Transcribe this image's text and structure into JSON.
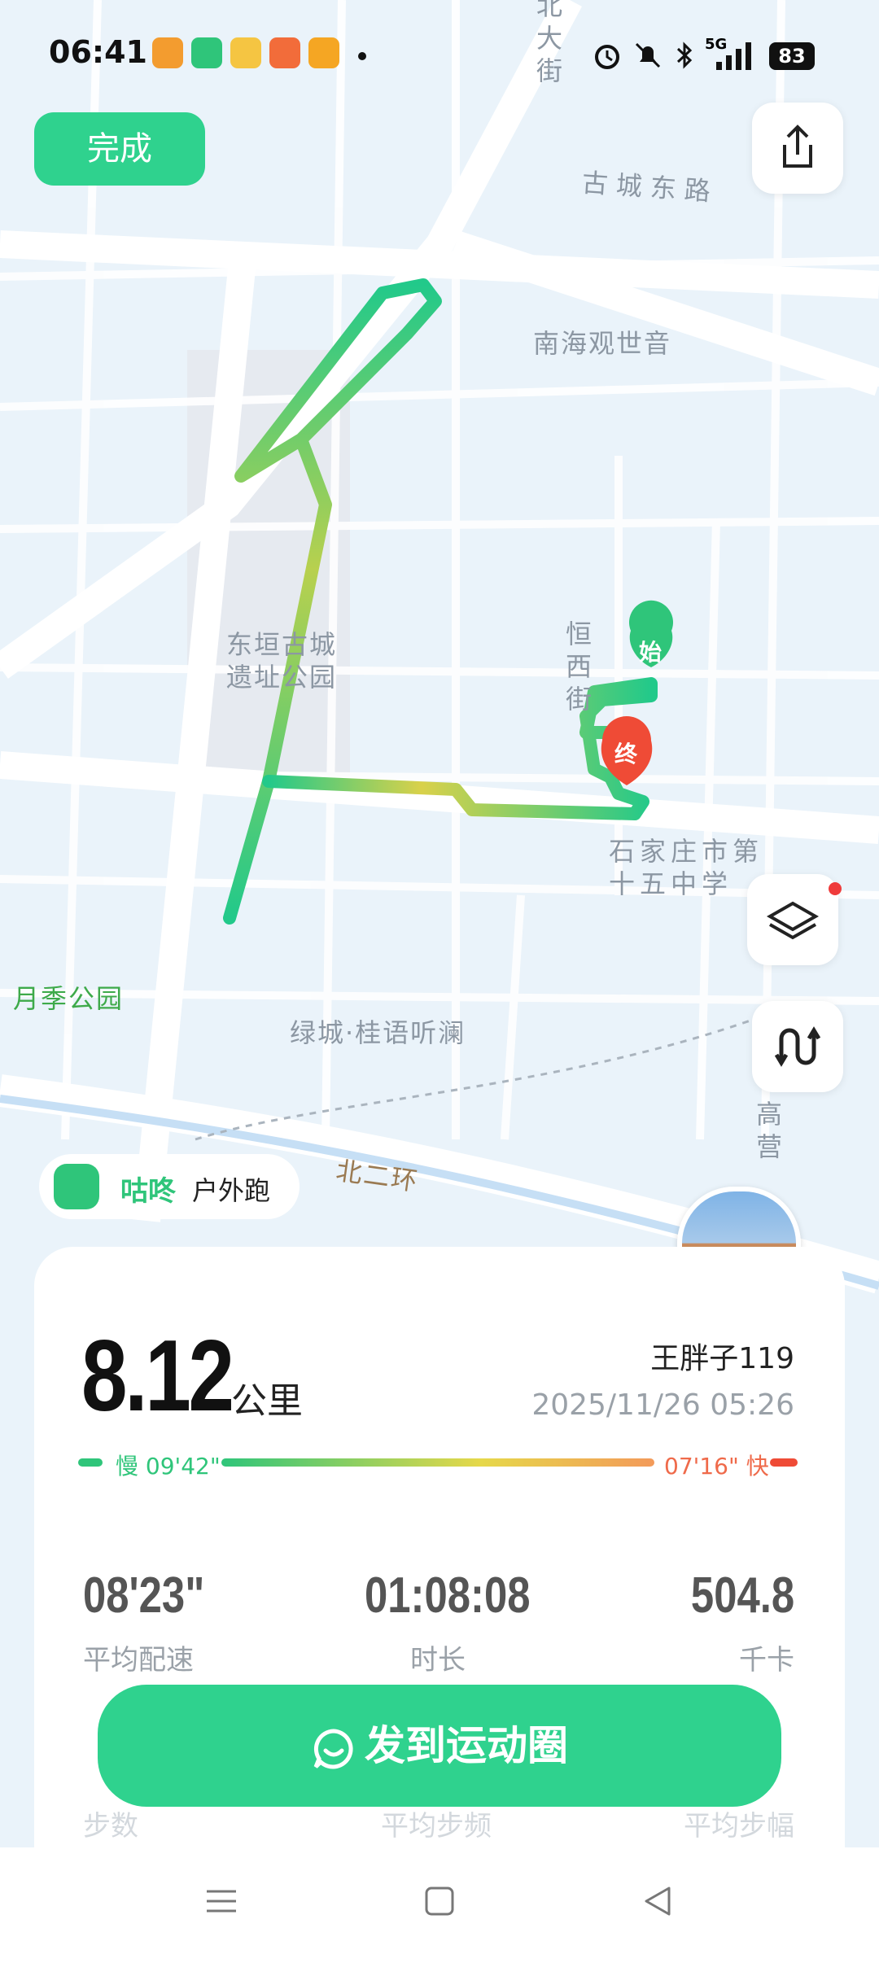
{
  "status_bar": {
    "time": "06:41",
    "network": "5G",
    "battery": "83",
    "icons": [
      "alarm-icon",
      "mute-bell-icon",
      "bluetooth-icon",
      "signal-icon"
    ]
  },
  "top_actions": {
    "done_label": "完成",
    "share_icon": "share-icon"
  },
  "map": {
    "labels": {
      "street_top": "北大街",
      "gucheng_east": "古城东路",
      "nanhai": "南海观世音",
      "park": "东垣古城\n遗址公园",
      "hengxi": "恒西街",
      "school": "石家庄市第\n十五中学",
      "yueji": "月季公园",
      "lvcheng": "绿城·桂语听澜",
      "beierhuan": "北二环",
      "gaoying": "高营"
    },
    "start_marker": "始",
    "end_marker": "终",
    "colors": {
      "route_green": "#22c98a",
      "route_yellow": "#d9d14a",
      "start": "#2fc57a",
      "end": "#ef4b36"
    }
  },
  "app_badge": {
    "brand": "咕咚",
    "activity": "户外跑"
  },
  "summary": {
    "distance": "8.12",
    "unit": "公里",
    "user": "王胖子119",
    "datetime": "2025/11/26 05:26",
    "pace_slow_label": "慢 09'42\"",
    "pace_fast_label": "07'16\" 快"
  },
  "stats": [
    {
      "value": "08'23\"",
      "label": "平均配速"
    },
    {
      "value": "01:08:08",
      "label": "时长"
    },
    {
      "value": "504.8",
      "label": "千卡"
    }
  ],
  "hidden_stats": [
    "步数",
    "平均步频",
    "平均步幅"
  ],
  "share_label": "发到运动圈"
}
